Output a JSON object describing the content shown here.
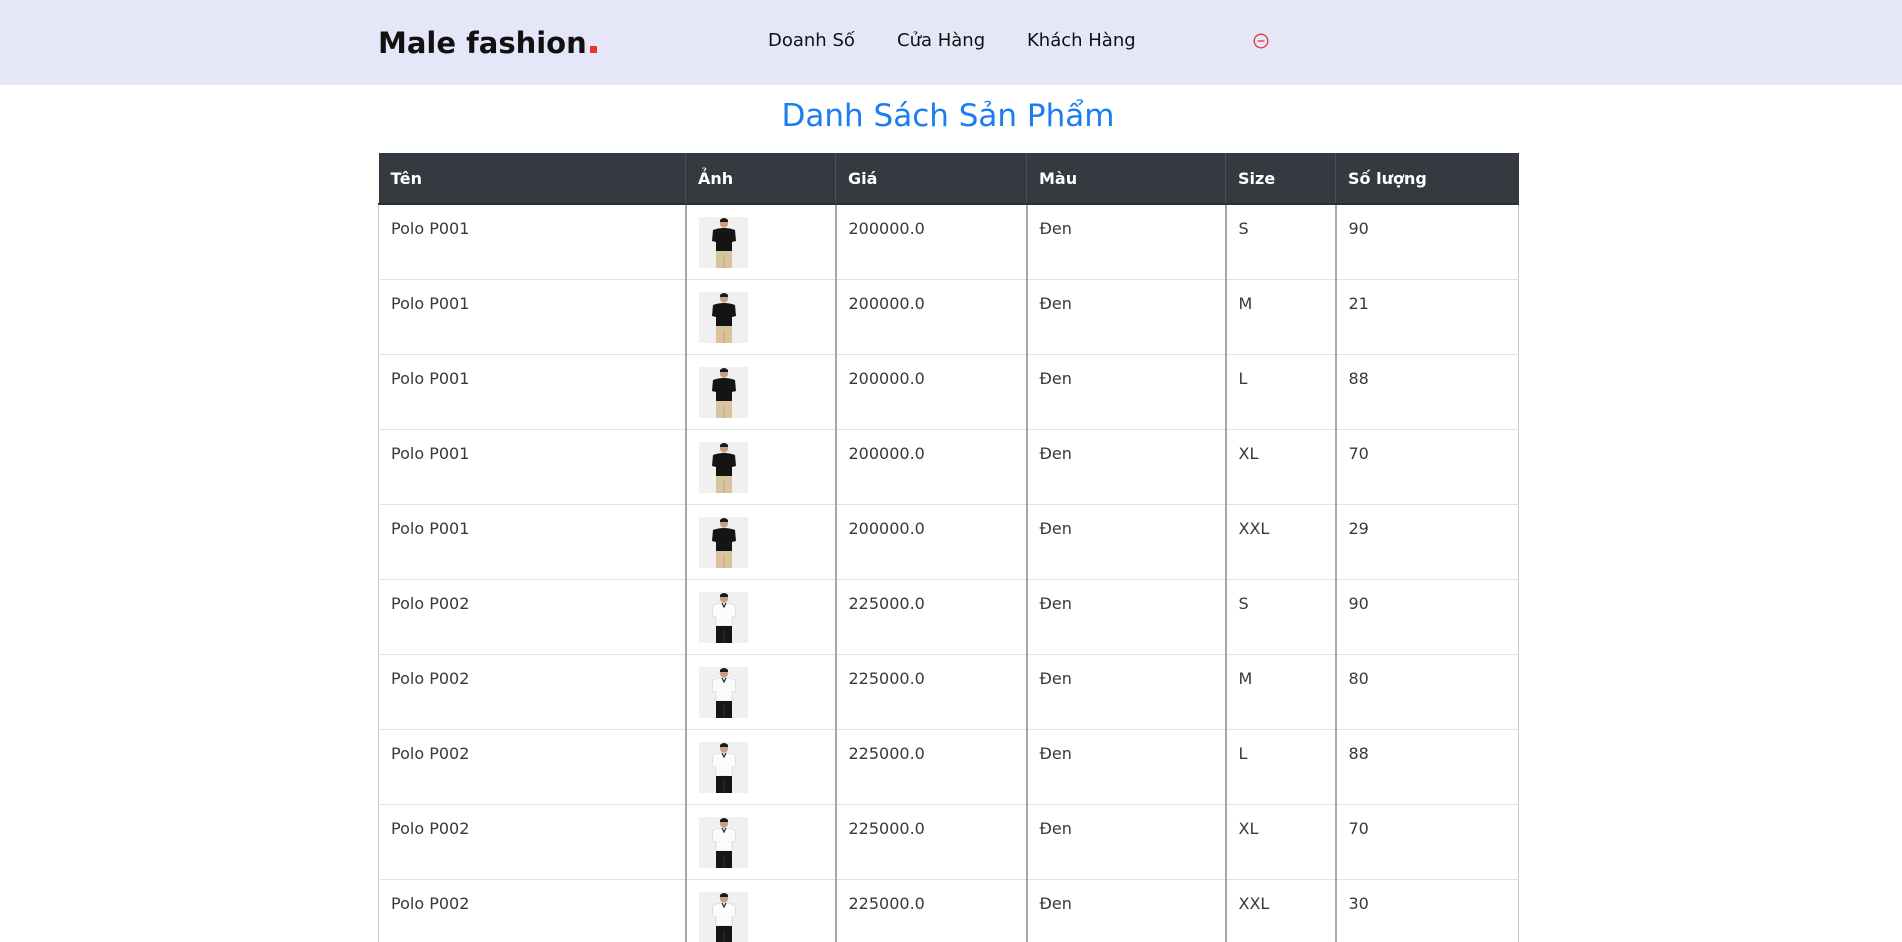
{
  "header": {
    "logo_text": "Male fashion",
    "nav": [
      {
        "label": "Doanh Số"
      },
      {
        "label": "Cửa Hàng"
      },
      {
        "label": "Khách Hàng"
      }
    ],
    "logout_icon": "minus-circle-icon",
    "logout_color": "#e53637",
    "background": "#e5e6f8"
  },
  "main": {
    "title": "Danh Sách Sản Phẩm",
    "title_color": "#1a7ef0",
    "table": {
      "columns": [
        "Tên",
        "Ảnh",
        "Giá",
        "Màu",
        "Size",
        "Số lượng"
      ],
      "header_background": "#343a40",
      "rows": [
        {
          "name": "Polo P001",
          "image": "black-polo-thumbnail",
          "price": "200000.0",
          "color": "Đen",
          "size": "S",
          "qty": "90"
        },
        {
          "name": "Polo P001",
          "image": "black-polo-thumbnail",
          "price": "200000.0",
          "color": "Đen",
          "size": "M",
          "qty": "21"
        },
        {
          "name": "Polo P001",
          "image": "black-polo-thumbnail",
          "price": "200000.0",
          "color": "Đen",
          "size": "L",
          "qty": "88"
        },
        {
          "name": "Polo P001",
          "image": "black-polo-thumbnail",
          "price": "200000.0",
          "color": "Đen",
          "size": "XL",
          "qty": "70"
        },
        {
          "name": "Polo P001",
          "image": "black-polo-thumbnail",
          "price": "200000.0",
          "color": "Đen",
          "size": "XXL",
          "qty": "29"
        },
        {
          "name": "Polo P002",
          "image": "white-polo-thumbnail",
          "price": "225000.0",
          "color": "Đen",
          "size": "S",
          "qty": "90"
        },
        {
          "name": "Polo P002",
          "image": "white-polo-thumbnail",
          "price": "225000.0",
          "color": "Đen",
          "size": "M",
          "qty": "80"
        },
        {
          "name": "Polo P002",
          "image": "white-polo-thumbnail",
          "price": "225000.0",
          "color": "Đen",
          "size": "L",
          "qty": "88"
        },
        {
          "name": "Polo P002",
          "image": "white-polo-thumbnail",
          "price": "225000.0",
          "color": "Đen",
          "size": "XL",
          "qty": "70"
        },
        {
          "name": "Polo P002",
          "image": "white-polo-thumbnail",
          "price": "225000.0",
          "color": "Đen",
          "size": "XXL",
          "qty": "30"
        }
      ]
    }
  }
}
